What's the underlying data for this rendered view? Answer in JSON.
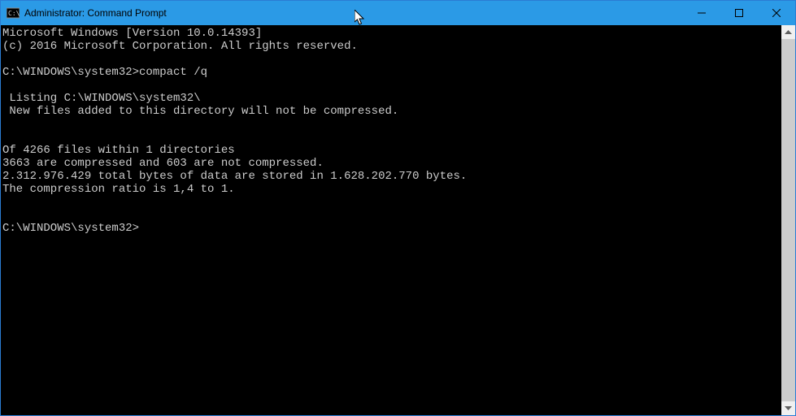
{
  "titlebar": {
    "title": "Administrator: Command Prompt"
  },
  "terminal": {
    "line1": "Microsoft Windows [Version 10.0.14393]",
    "line2": "(c) 2016 Microsoft Corporation. All rights reserved.",
    "line3": "",
    "line4": "C:\\WINDOWS\\system32>compact /q",
    "line5": "",
    "line6": " Listing C:\\WINDOWS\\system32\\",
    "line7": " New files added to this directory will not be compressed.",
    "line8": "",
    "line9": "",
    "line10": "Of 4266 files within 1 directories",
    "line11": "3663 are compressed and 603 are not compressed.",
    "line12": "2.312.976.429 total bytes of data are stored in 1.628.202.770 bytes.",
    "line13": "The compression ratio is 1,4 to 1.",
    "line14": "",
    "line15": "",
    "line16": "C:\\WINDOWS\\system32>"
  }
}
